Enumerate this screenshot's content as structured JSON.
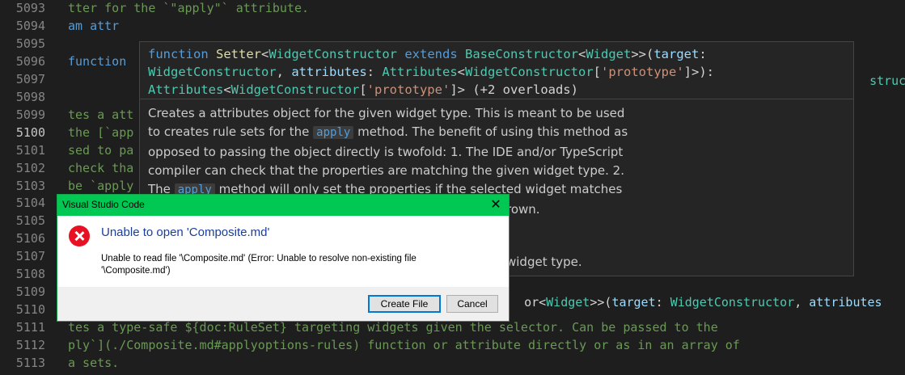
{
  "editor": {
    "lines": [
      {
        "num": "5093",
        "text": "tter for the `\"apply\"` attribute.",
        "cls": "green",
        "active": false
      },
      {
        "num": "5094",
        "text": "am attr",
        "cls": "kw",
        "active": false
      },
      {
        "num": "5095",
        "text": "",
        "cls": "green",
        "active": false
      },
      {
        "num": "5096",
        "text": "function",
        "cls": "kw",
        "active": false
      },
      {
        "num": "5097",
        "text": "",
        "cls": "green",
        "active": false
      },
      {
        "num": "5098",
        "text": "",
        "cls": "green",
        "active": false
      },
      {
        "num": "5099",
        "text": "tes a att",
        "cls": "green",
        "active": false
      },
      {
        "num": "5100",
        "text": "the [`app",
        "cls": "green",
        "active": true
      },
      {
        "num": "5101",
        "text": "sed to pa",
        "cls": "green",
        "active": false
      },
      {
        "num": "5102",
        "text": "check tha",
        "cls": "green",
        "active": false
      },
      {
        "num": "5103",
        "text": "be `apply",
        "cls": "green",
        "active": false
      },
      {
        "num": "5104",
        "text": "",
        "cls": "green",
        "active": false
      },
      {
        "num": "5105",
        "text": "",
        "cls": "green",
        "active": false
      },
      {
        "num": "5106",
        "text": "",
        "cls": "green",
        "active": false
      },
      {
        "num": "5107",
        "text": "",
        "cls": "green",
        "active": false
      },
      {
        "num": "5108",
        "text": "",
        "cls": "green",
        "active": false
      },
      {
        "num": "5109",
        "text": "",
        "cls": "green",
        "active": false
      },
      {
        "num": "5110",
        "text": "",
        "cls": "green",
        "active": false
      },
      {
        "num": "5111",
        "text": "tes a type-safe ${doc:RuleSet} targeting widgets given the selector. Can be passed to the",
        "cls": "green",
        "active": false
      },
      {
        "num": "5112",
        "text": "ply`](./Composite.md#applyoptions-rules) function or attribute directly or as in an array of",
        "cls": "green",
        "active": false
      },
      {
        "num": "5113",
        "text": "a sets.",
        "cls": "green",
        "active": false
      }
    ],
    "right_overflow_5096": "structo",
    "line_5108_tail": {
      "a": "or<",
      "b": "Widget",
      "c": ">>(",
      "d": "target",
      "e": ": ",
      "f": "WidgetConstructor",
      "g": ", ",
      "h": "attributes"
    }
  },
  "hover": {
    "sig": {
      "kw1": "function",
      "fn": "Setter",
      "lt1": "<",
      "tp1": "WidgetConstructor",
      "kw2": "extends",
      "tp2": "BaseConstructor",
      "lt2": "<",
      "tp3": "Widget",
      "p1": ">>(",
      "param1": "target",
      "c1": ":",
      "tp4": "WidgetConstructor",
      "c2": ",",
      "param2": "attributes",
      "c3": ":",
      "tp5": "Attributes",
      "lt3": "<",
      "tp6": "WidgetConstructor",
      "br1": "[",
      "str1": "'prototype'",
      "br2": "]>):",
      "tp7": "Attributes",
      "lt4": "<",
      "tp8": "WidgetConstructor",
      "br3": "[",
      "str2": "'prototype'",
      "br4": "]>",
      "overloads": "(+2 overloads)"
    },
    "doc": {
      "p1a": "Creates a attributes object for the given widget type. This is meant to be used to creates rule sets for the",
      "chip1": "apply",
      "p1b": "method. The benefit of using this method as opposed to passing the object directly is twofold: 1. The IDE and/or TypeScript compiler can check that the properties are matching the given widget type. 2. The",
      "chip2": "apply",
      "p1c": "method will only set the properties if the selected widget matches",
      "tail1": "rown.",
      "tail2": "widget type."
    }
  },
  "dialog": {
    "title": "Visual Studio Code",
    "close_glyph": "✕",
    "heading": "Unable to open 'Composite.md'",
    "message": "Unable to read file '\\Composite.md' (Error: Unable to resolve non-existing file '\\Composite.md')",
    "primary_button": "Create File",
    "cancel_button": "Cancel",
    "colors": {
      "title_bar": "#00c853",
      "heading": "#1a3e9c",
      "error": "#e81123"
    }
  }
}
